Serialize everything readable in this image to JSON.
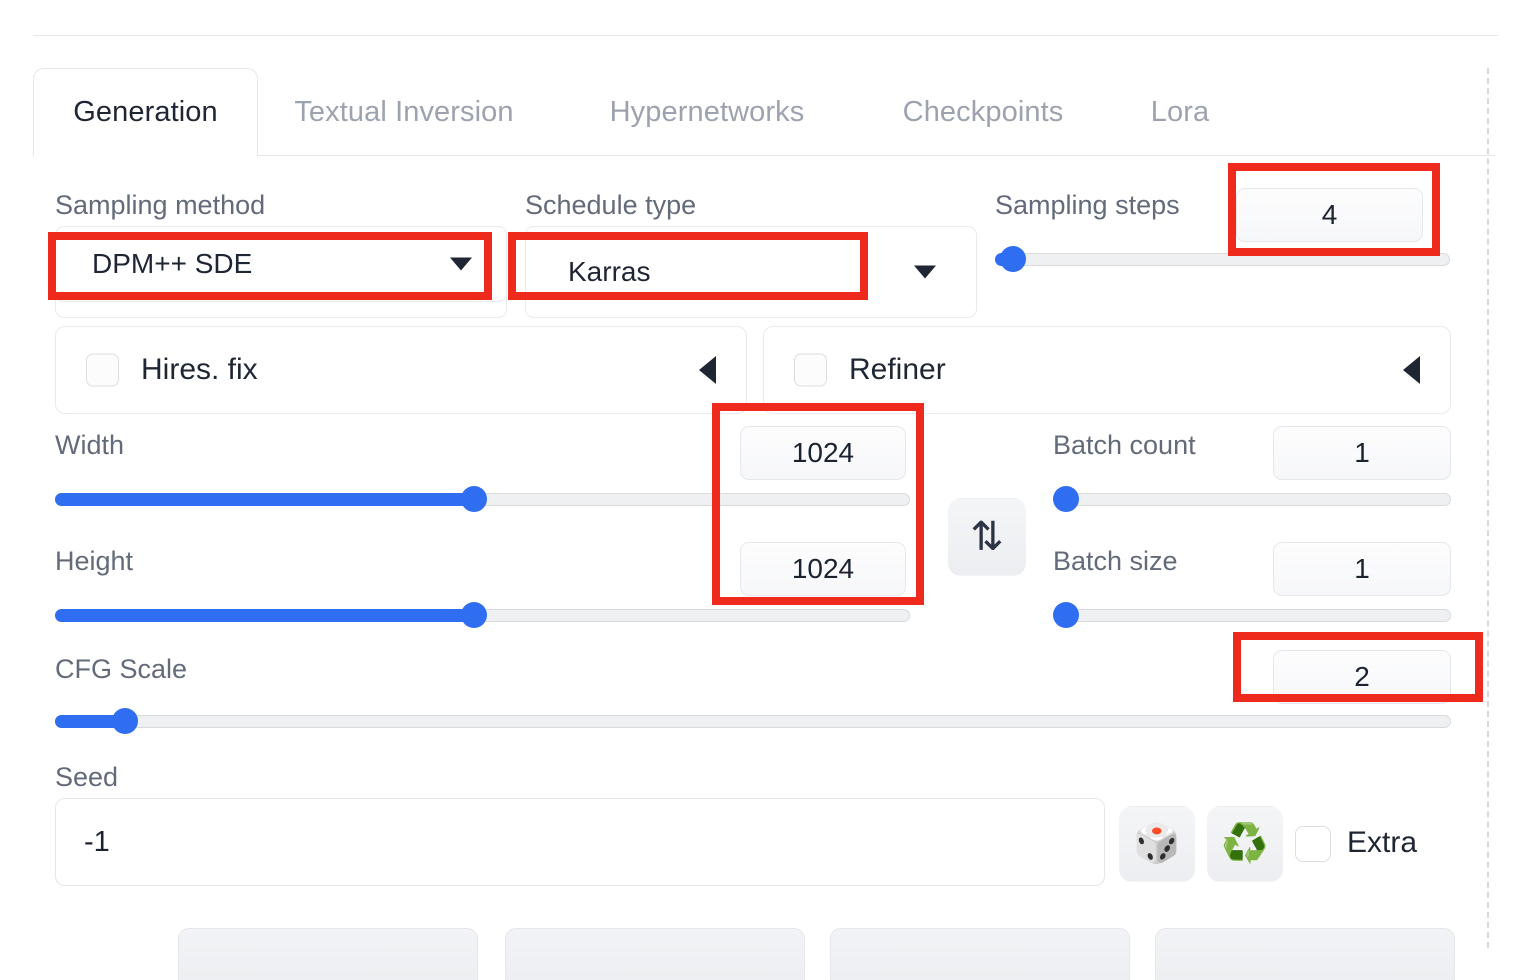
{
  "app": {
    "accent_blue": "#2f6ef0",
    "annotation_color": "#ee2a1c",
    "text_primary": "#1f2633",
    "text_muted": "#636b7a"
  },
  "tabs": [
    {
      "label": "Generation",
      "active": true
    },
    {
      "label": "Textual Inversion",
      "active": false
    },
    {
      "label": "Hypernetworks",
      "active": false
    },
    {
      "label": "Checkpoints",
      "active": false
    },
    {
      "label": "Lora",
      "active": false
    }
  ],
  "sampling": {
    "method_label": "Sampling method",
    "method_value": "DPM++ SDE",
    "schedule_label": "Schedule type",
    "schedule_value": "Karras",
    "steps_label": "Sampling steps",
    "steps_value": "4",
    "steps_percent": 4
  },
  "accordions": [
    {
      "title": "Hires. fix",
      "checked": false,
      "arrow": "collapse-arrow-icon"
    },
    {
      "title": "Refiner",
      "checked": false,
      "arrow": "collapse-arrow-icon"
    }
  ],
  "dimensions": {
    "width_label": "Width",
    "width_value": "1024",
    "width_percent": 49,
    "height_label": "Height",
    "height_value": "1024",
    "height_percent": 49,
    "swap_icon": "swap-dimensions-icon",
    "swap_glyph": "⇅"
  },
  "batch": {
    "count_label": "Batch count",
    "count_value": "1",
    "count_percent": 0,
    "size_label": "Batch size",
    "size_value": "1",
    "size_percent": 0
  },
  "cfg": {
    "label": "CFG Scale",
    "value": "2",
    "percent": 5
  },
  "seed": {
    "label": "Seed",
    "value": "-1",
    "dice_icon": "dice-icon",
    "dice_glyph": "🎲",
    "recycle_icon": "recycle-icon",
    "recycle_glyph": "♻️",
    "extra_label": "Extra",
    "extra_checked": false
  },
  "annotations": [
    {
      "target": "sampling-method-dropdown"
    },
    {
      "target": "schedule-type-dropdown"
    },
    {
      "target": "sampling-steps-value"
    },
    {
      "target": "width-height-values"
    },
    {
      "target": "cfg-scale-value"
    }
  ]
}
